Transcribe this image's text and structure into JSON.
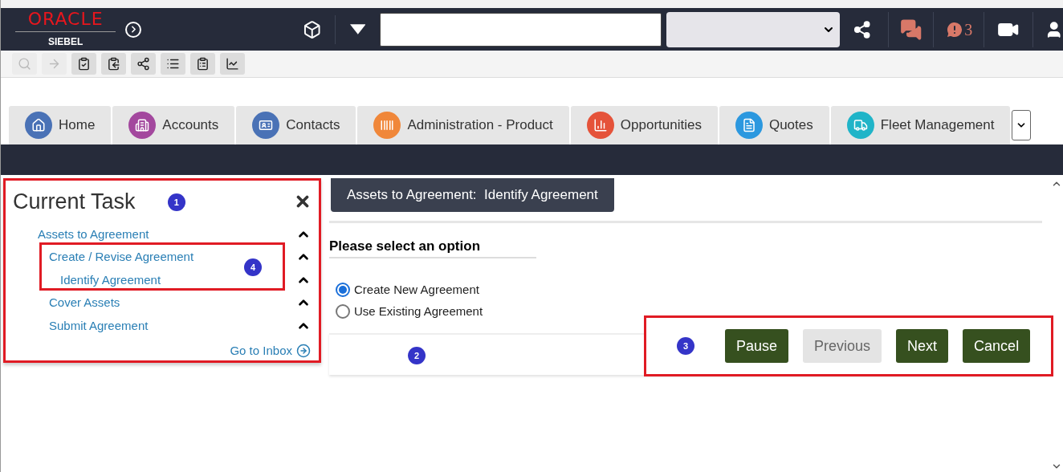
{
  "header": {
    "logo": {
      "brand": "ORACLE",
      "product": "SIEBEL"
    },
    "alerts_count": "3"
  },
  "tabs": [
    {
      "label": "Home",
      "color": "#4a72b6",
      "selected": false
    },
    {
      "label": "Accounts",
      "color": "#a3489e",
      "selected": false
    },
    {
      "label": "Contacts",
      "color": "#4a72b6",
      "selected": false
    },
    {
      "label": "Administration - Product",
      "color": "#f0873a",
      "selected": false
    },
    {
      "label": "Opportunities",
      "color": "#e5533a",
      "selected": false
    },
    {
      "label": "Quotes",
      "color": "#2c98df",
      "selected": false
    },
    {
      "label": "Fleet Management",
      "color": "#20b4c8",
      "selected": false
    }
  ],
  "current_task": {
    "title": "Current Task",
    "tree": [
      {
        "label": "Assets to Agreement",
        "children": [
          {
            "label": "Create / Revise Agreement",
            "children": [
              {
                "label": "Identify Agreement"
              }
            ]
          },
          {
            "label": "Cover Assets"
          },
          {
            "label": "Submit Agreement"
          }
        ]
      }
    ],
    "inbox_link": "Go to Inbox"
  },
  "view": {
    "title": "Assets to Agreement:  Identify Agreement",
    "prompt": "Please select an option",
    "options": [
      {
        "label": "Create New Agreement",
        "selected": true
      },
      {
        "label": "Use Existing Agreement",
        "selected": false
      }
    ],
    "buttons": [
      {
        "label": "Pause",
        "disabled": false
      },
      {
        "label": "Previous",
        "disabled": true
      },
      {
        "label": "Next",
        "disabled": false
      },
      {
        "label": "Cancel",
        "disabled": false
      }
    ]
  },
  "callouts": [
    "1",
    "2",
    "3",
    "4"
  ]
}
